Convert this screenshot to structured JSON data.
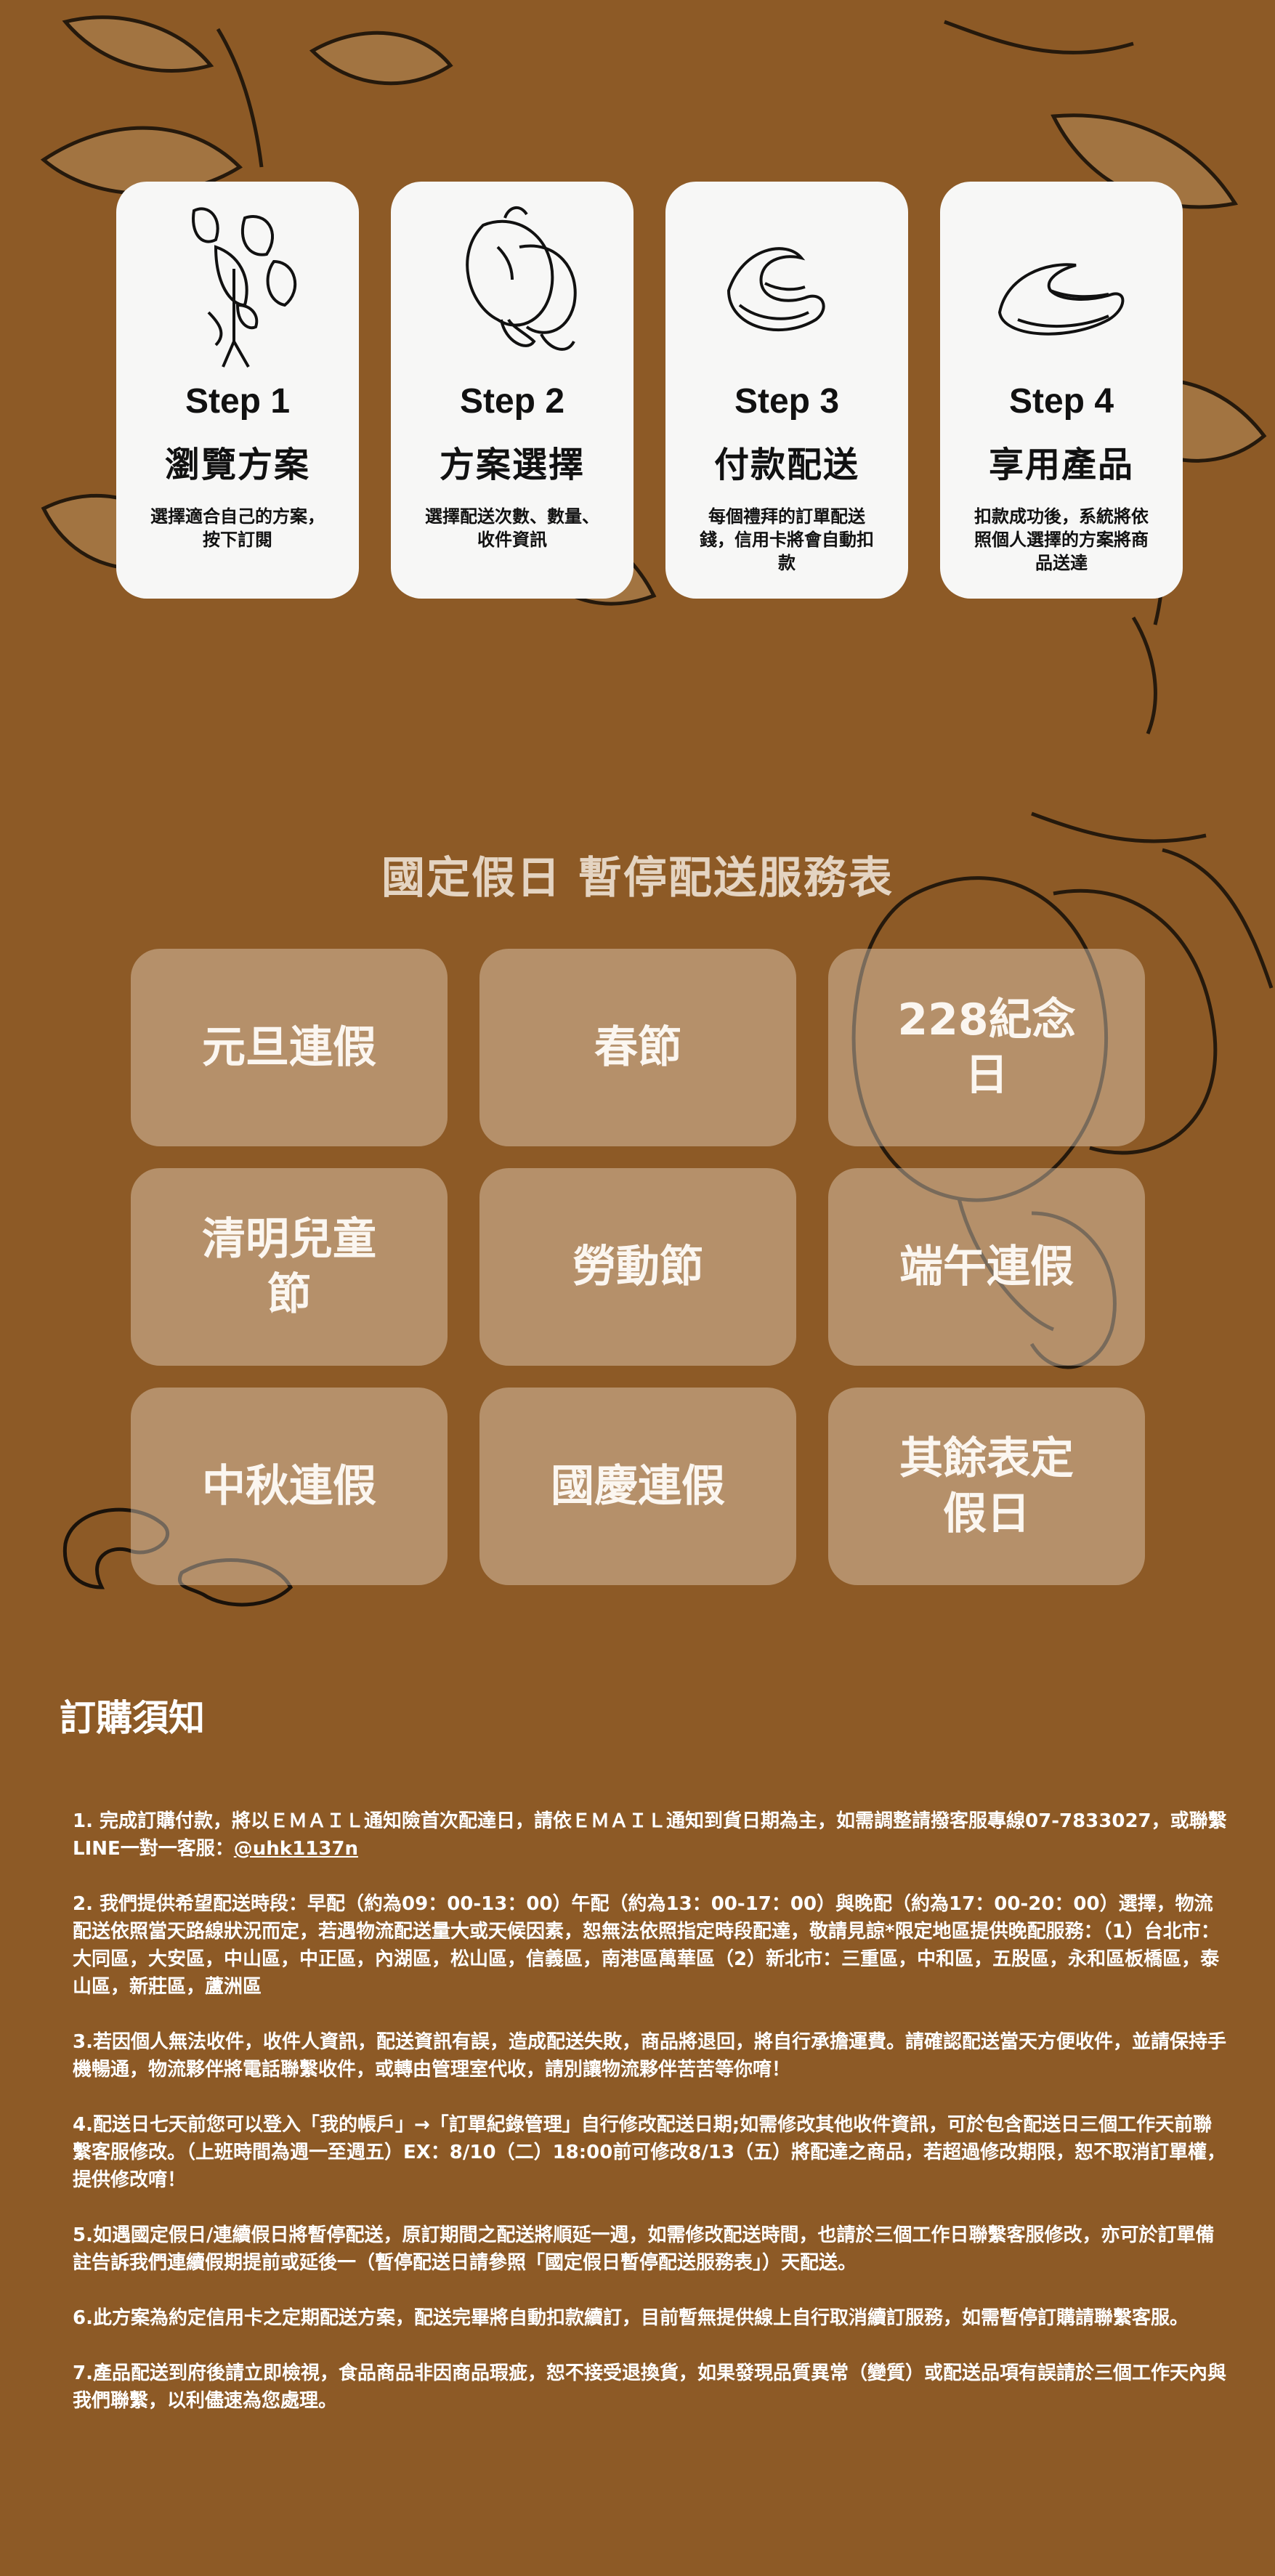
{
  "steps": [
    {
      "step": "Step 1",
      "title": "瀏覽方案",
      "desc": "選擇適合自己的方案，按下訂閱",
      "icon": "cashew-branch-icon"
    },
    {
      "step": "Step 2",
      "title": "方案選擇",
      "desc": "選擇配送次數、數量、收件資訊",
      "icon": "cashew-fruit-icon"
    },
    {
      "step": "Step 3",
      "title": "付款配送",
      "desc": "每個禮拜的訂單配送錢，信用卡將會自動扣款",
      "icon": "cashew-nut-icon"
    },
    {
      "step": "Step 4",
      "title": "享用產品",
      "desc": "扣款成功後，系統將依照個人選擇的方案將商品送達",
      "icon": "cashew-nut-icon"
    }
  ],
  "holiday": {
    "title": "國定假日 暫停配送服務表",
    "items": [
      "元旦連假",
      "春節",
      "228紀念日",
      "清明兒童節",
      "勞動節",
      "端午連假",
      "中秋連假",
      "國慶連假",
      "其餘表定假日"
    ]
  },
  "notice": {
    "title": "訂購須知",
    "item1_text": "1. 完成訂購付款，將以ＥＭＡＩＬ通知險首次配達日，請依ＥＭＡＩＬ通知到貨日期為主，如需調整請撥客服專線07-7833027，或聯繫LINE一對一客服：",
    "item1_link": "@uhk1137n",
    "items": [
      "2.  我們提供希望配送時段：早配（約為09：00-13：00）午配（約為13：00-17：00）與晚配（約為17：00-20：00）選擇，物流配送依照當天路線狀況而定，若遇物流配送量大或天候因素，恕無法依照指定時段配達，敬請見諒*限定地區提供晚配服務：（1）台北市：大同區，大安區，中山區，中正區，內湖區，松山區，信義區，南港區萬華區（2）新北市：三重區，中和區，五股區，永和區板橋區，泰山區，新莊區，蘆洲區",
      "3.若因個人無法收件，收件人資訊，配送資訊有誤，造成配送失敗，商品將退回，將自行承擔運費。請確認配送當天方便收件，並請保持手機暢通，物流夥伴將電話聯繫收件，或轉由管理室代收，請別讓物流夥伴苦苦等你唷！",
      "4.配送日七天前您可以登入「我的帳戶」→「訂單紀錄管理」自行修改配送日期;如需修改其他收件資訊，可於包含配送日三個工作天前聯繫客服修改。（上班時間為週一至週五）EX：8/10（二）18:00前可修改8/13（五）將配達之商品，若超過修改期限，恕不取消訂單權，提供修改唷！",
      "5.如遇國定假日/連續假日將暫停配送，原訂期間之配送將順延一週，如需修改配送時間，也請於三個工作日聯繫客服修改，亦可於訂單備註告訴我們連續假期提前或延後一（暫停配送日請參照「國定假日暫停配送服務表」）天配送。",
      " 6.此方案為約定信用卡之定期配送方案，配送完畢將自動扣款續訂，目前暫無提供線上自行取消續訂服務，如需暫停訂購請聯繫客服。",
      "7.產品配送到府後請立即檢視，食品商品非因商品瑕疵，恕不接受退換貨，如果發現品質異常（變質）或配送品項有誤請於三個工作天內與我們聯繫，以利儘速為您處理。"
    ]
  },
  "colors": {
    "background": "#8d5a26",
    "card": "#f7f7f6",
    "holiday_card": "rgba(235,220,200,0.42)"
  }
}
